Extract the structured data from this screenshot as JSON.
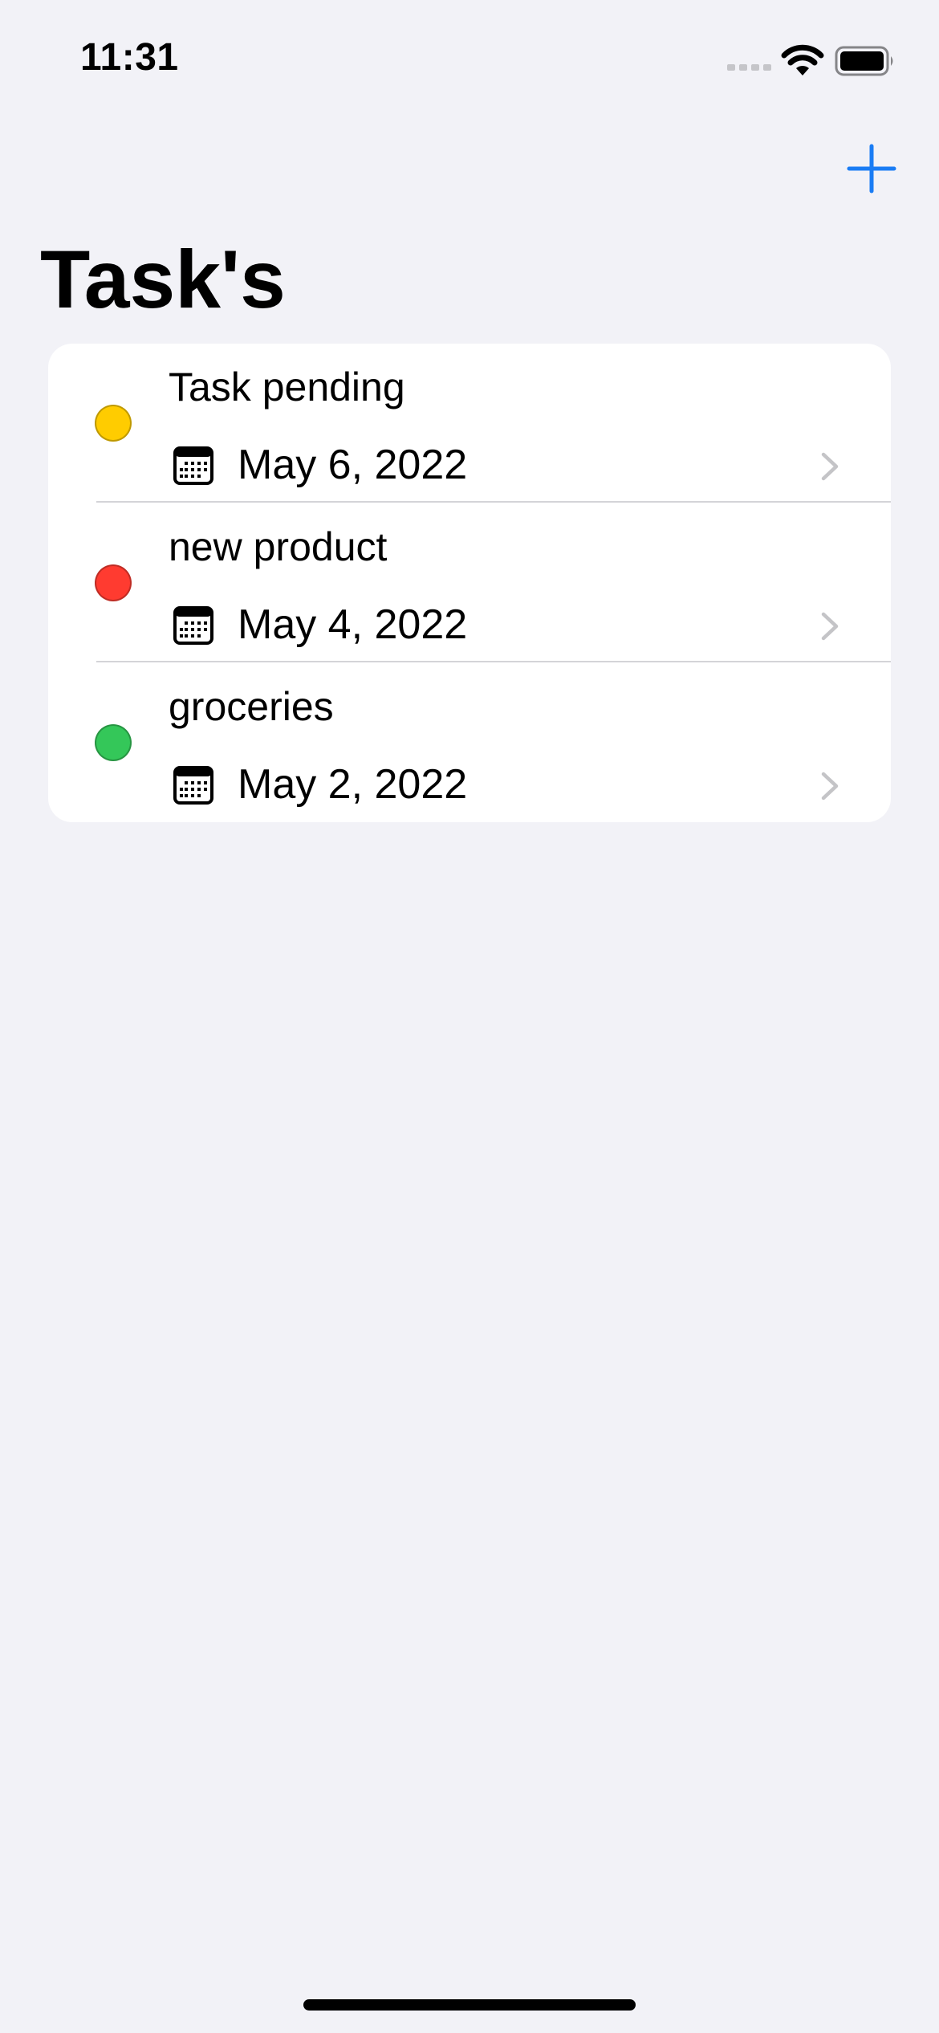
{
  "status_bar": {
    "time": "11:31"
  },
  "nav": {
    "title": "Task's",
    "add_icon": "plus-icon",
    "accent_color": "#1a7cf4"
  },
  "tasks": [
    {
      "title": "Task pending",
      "date": "May 6, 2022",
      "status_color": "#ffcc00"
    },
    {
      "title": "new product",
      "date": "May 4, 2022",
      "status_color": "#ff3b30"
    },
    {
      "title": "groceries",
      "date": "May 2, 2022",
      "status_color": "#34c759"
    }
  ],
  "icons": {
    "date": "calendar-icon",
    "row": "chevron-right-icon"
  }
}
